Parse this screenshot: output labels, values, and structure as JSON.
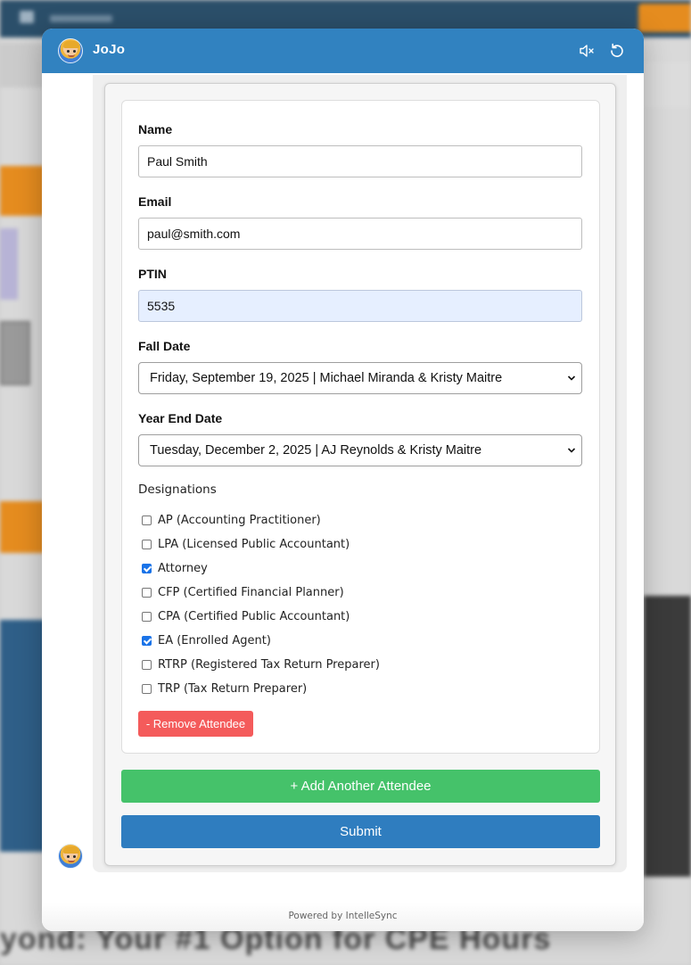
{
  "background": {
    "headline": "yond: Your #1 Option for CPE Hours"
  },
  "header": {
    "title": "JoJo",
    "icons": {
      "mute": "volume-mute-icon",
      "refresh": "refresh-icon"
    }
  },
  "form": {
    "name": {
      "label": "Name",
      "value": "Paul Smith"
    },
    "email": {
      "label": "Email",
      "value": "paul@smith.com"
    },
    "ptin": {
      "label": "PTIN",
      "value": "5535"
    },
    "fall_date": {
      "label": "Fall Date",
      "selected": "Friday, September 19, 2025 | Michael Miranda & Kristy Maitre"
    },
    "year_end_date": {
      "label": "Year End Date",
      "selected": "Tuesday, December 2, 2025 | AJ Reynolds & Kristy Maitre"
    },
    "designations": {
      "title": "Designations",
      "options": [
        {
          "label": "AP (Accounting Practitioner)",
          "checked": false
        },
        {
          "label": "LPA (Licensed Public Accountant)",
          "checked": false
        },
        {
          "label": "Attorney",
          "checked": true
        },
        {
          "label": "CFP (Certified Financial Planner)",
          "checked": false
        },
        {
          "label": "CPA (Certified Public Accountant)",
          "checked": false
        },
        {
          "label": "EA (Enrolled Agent)",
          "checked": true
        },
        {
          "label": "RTRP (Registered Tax Return Preparer)",
          "checked": false
        },
        {
          "label": "TRP (Tax Return Preparer)",
          "checked": false
        }
      ]
    },
    "remove_label": "- Remove Attendee",
    "add_label": "+ Add Another Attendee",
    "submit_label": "Submit"
  },
  "footer": {
    "text": "Powered by IntelleSync"
  },
  "colors": {
    "header": "#3182c0",
    "add_button": "#45c26a",
    "submit_button": "#2f7dbf",
    "remove_button": "#f45b5b",
    "autofill": "#e6efff"
  }
}
